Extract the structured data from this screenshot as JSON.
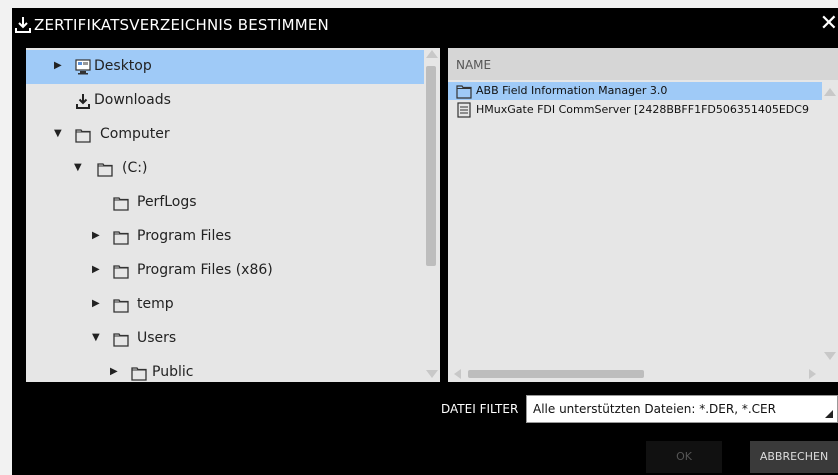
{
  "dialog": {
    "title": "ZERTIFIKATSVERZEICHNIS BESTIMMEN",
    "title_icon": "download-icon",
    "close_label": "✕"
  },
  "tree": {
    "items": [
      {
        "label": "Desktop",
        "icon": "desktop-icon",
        "arrow": "▶",
        "selected": true
      },
      {
        "label": "Downloads",
        "icon": "download-icon",
        "arrow": ""
      },
      {
        "label": "Computer",
        "icon": "folder-icon",
        "arrow": "▼"
      },
      {
        "label": "(C:)",
        "icon": "folder-icon",
        "arrow": "▼"
      },
      {
        "label": "PerfLogs",
        "icon": "folder-icon",
        "arrow": ""
      },
      {
        "label": "Program Files",
        "icon": "folder-icon",
        "arrow": "▶"
      },
      {
        "label": "Program Files (x86)",
        "icon": "folder-icon",
        "arrow": "▶"
      },
      {
        "label": "temp",
        "icon": "folder-icon",
        "arrow": "▶"
      },
      {
        "label": "Users",
        "icon": "folder-icon",
        "arrow": "▼"
      },
      {
        "label": "Public",
        "icon": "folder-icon",
        "arrow": "▶"
      }
    ]
  },
  "files": {
    "column_header": "NAME",
    "rows": [
      {
        "name": "ABB Field Information Manager 3.0",
        "icon": "folder-icon",
        "selected": true
      },
      {
        "name": "HMuxGate FDI CommServer [2428BBFF1FD506351405EDC9",
        "icon": "file-icon",
        "selected": false
      }
    ]
  },
  "filter": {
    "label": "DATEI FILTER",
    "value": "Alle unterstützten Dateien: *.DER, *.CER"
  },
  "buttons": {
    "ok": "OK",
    "cancel": "ABBRECHEN"
  },
  "colors": {
    "selection": "#9fcaf7",
    "dialog_bg": "#000000",
    "panel_bg": "#e6e6e6"
  }
}
